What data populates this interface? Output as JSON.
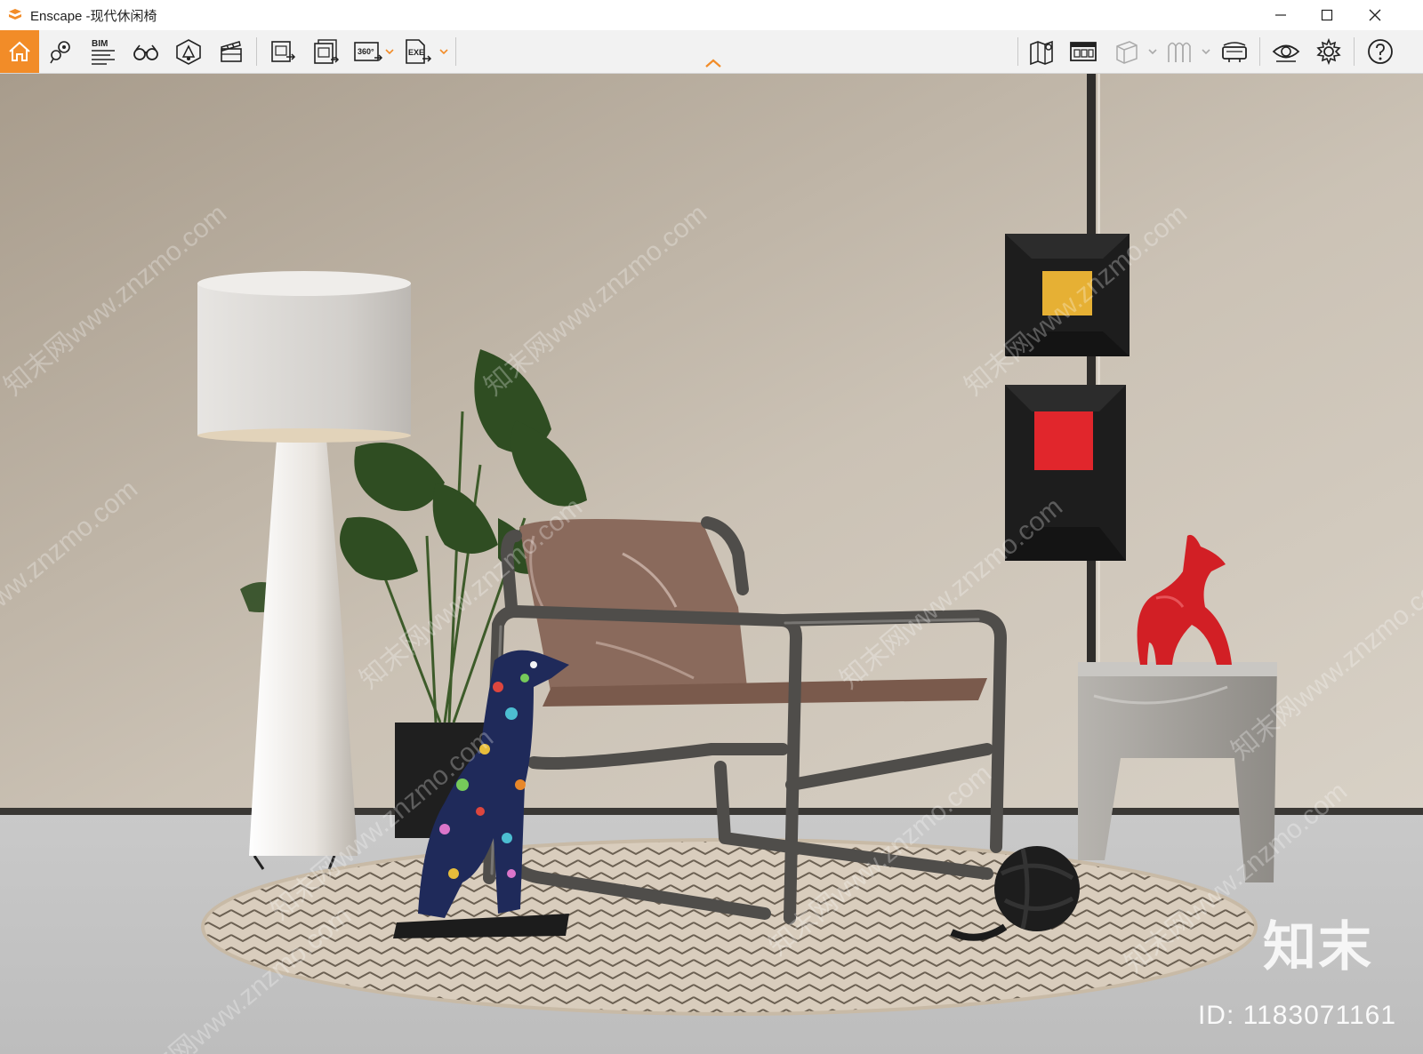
{
  "window": {
    "title": "Enscape -现代休闲椅",
    "controls": {
      "minimize": "minimize-icon",
      "maximize": "maximize-icon",
      "close": "close-icon"
    }
  },
  "toolbar": {
    "left_tools": [
      {
        "name": "home",
        "icon": "home-icon",
        "active": true
      },
      {
        "name": "view-management",
        "icon": "location-views-icon"
      },
      {
        "name": "bim-info",
        "icon": "bim-icon",
        "label": "BIM"
      },
      {
        "name": "walk-mode",
        "icon": "binoculars-icon"
      },
      {
        "name": "asset-library",
        "icon": "asset-library-icon"
      },
      {
        "name": "video-editor",
        "icon": "clapperboard-icon"
      },
      {
        "name": "render-image",
        "icon": "export-image-icon"
      },
      {
        "name": "batch-render",
        "icon": "batch-render-icon"
      },
      {
        "name": "render-360",
        "icon": "panorama-360-icon",
        "label": "360°"
      },
      {
        "name": "export-exe",
        "icon": "export-exe-icon",
        "label": "EXE"
      }
    ],
    "right_tools": [
      {
        "name": "minimap",
        "icon": "map-icon"
      },
      {
        "name": "capture-info",
        "icon": "capture-icon"
      },
      {
        "name": "section-box",
        "icon": "cube-icon"
      },
      {
        "name": "visual-presets",
        "icon": "presets-icon"
      },
      {
        "name": "vr-headset",
        "icon": "vr-headset-icon"
      },
      {
        "name": "visual-settings",
        "icon": "eye-icon"
      },
      {
        "name": "settings",
        "icon": "gear-icon"
      },
      {
        "name": "help",
        "icon": "help-icon"
      }
    ],
    "collapse": "chevron-up-icon",
    "accent_color": "#f28c28"
  },
  "watermark": {
    "text": "知末网www.znzmo.com",
    "logo": "知末",
    "id_text": "ID: 1183071161"
  }
}
